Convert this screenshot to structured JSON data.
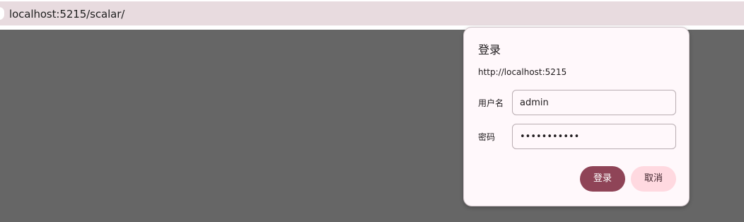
{
  "browser": {
    "url": "localhost:5215/scalar/"
  },
  "dialog": {
    "title": "登录",
    "origin": "http://localhost:5215",
    "username_label": "用户名",
    "username_value": "admin",
    "password_label": "密码",
    "password_value": "admin123456",
    "login_label": "登录",
    "cancel_label": "取消"
  },
  "colors": {
    "address_bar_bg": "#e8dbdf",
    "page_overlay": "#666666",
    "dialog_bg": "#fff8fb",
    "primary_button": "#8f4457",
    "secondary_button": "#ffd9e0"
  }
}
